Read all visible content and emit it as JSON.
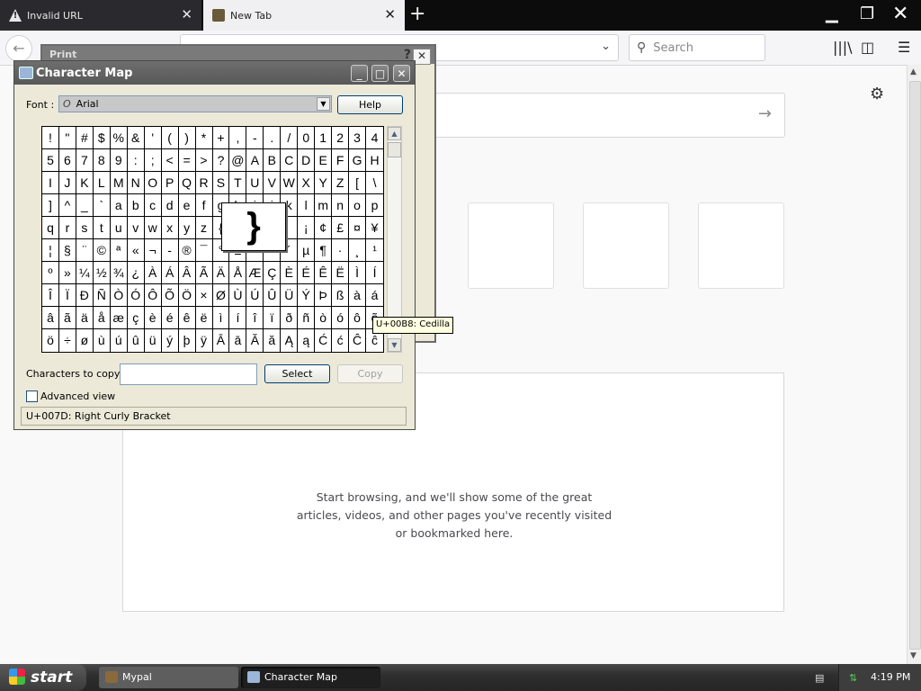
{
  "browser": {
    "tabs": [
      {
        "title": "Invalid URL",
        "icon": "warning-icon"
      },
      {
        "title": "New Tab",
        "icon": "site-icon"
      }
    ],
    "search_placeholder": "Search",
    "empty_message": "Start browsing, and we'll show some of the great articles, videos, and other pages you've recently visited or bookmarked here."
  },
  "print_dialog": {
    "title": "Print",
    "help_glyph": "?"
  },
  "charmap": {
    "title": "Character Map",
    "font_label": "Font :",
    "font_value": "Arial",
    "help_button": "Help",
    "chars_to_copy_label": "Characters to copy :",
    "chars_to_copy_value": "",
    "select_button": "Select",
    "copy_button": "Copy",
    "advanced_view_label": "Advanced view",
    "status": "U+007D: Right Curly Bracket",
    "magnified_char": "}",
    "tooltip": "U+00B8: Cedilla",
    "grid": [
      [
        "!",
        "\"",
        "#",
        "$",
        "%",
        "&",
        "'",
        "(",
        ")",
        "*",
        "+",
        ",",
        "-",
        ".",
        "/",
        "0",
        "1",
        "2",
        "3",
        "4"
      ],
      [
        "5",
        "6",
        "7",
        "8",
        "9",
        ":",
        ";",
        "<",
        "=",
        ">",
        "?",
        "@",
        "A",
        "B",
        "C",
        "D",
        "E",
        "F",
        "G",
        "H"
      ],
      [
        "I",
        "J",
        "K",
        "L",
        "M",
        "N",
        "O",
        "P",
        "Q",
        "R",
        "S",
        "T",
        "U",
        "V",
        "W",
        "X",
        "Y",
        "Z",
        "[",
        "\\"
      ],
      [
        "]",
        "^",
        "_",
        "`",
        "a",
        "b",
        "c",
        "d",
        "e",
        "f",
        "g",
        "h",
        "i",
        "j",
        "k",
        "l",
        "m",
        "n",
        "o",
        "p"
      ],
      [
        "q",
        "r",
        "s",
        "t",
        "u",
        "v",
        "w",
        "x",
        "y",
        "z",
        "{",
        "|",
        "}",
        "~",
        "",
        "¡",
        "¢",
        "£",
        "¤",
        "¥"
      ],
      [
        "¦",
        "§",
        "¨",
        "©",
        "ª",
        "«",
        "¬",
        "-",
        "®",
        "¯",
        "°",
        "±",
        "²",
        "³",
        "´",
        "µ",
        "¶",
        "·",
        "¸",
        "¹"
      ],
      [
        "º",
        "»",
        "¼",
        "½",
        "¾",
        "¿",
        "À",
        "Á",
        "Â",
        "Ã",
        "Ä",
        "Å",
        "Æ",
        "Ç",
        "È",
        "É",
        "Ê",
        "Ë",
        "Ì",
        "Í"
      ],
      [
        "Î",
        "Ï",
        "Ð",
        "Ñ",
        "Ò",
        "Ó",
        "Ô",
        "Õ",
        "Ö",
        "×",
        "Ø",
        "Ù",
        "Ú",
        "Û",
        "Ü",
        "Ý",
        "Þ",
        "ß",
        "à",
        "á"
      ],
      [
        "â",
        "ã",
        "ä",
        "å",
        "æ",
        "ç",
        "è",
        "é",
        "ê",
        "ë",
        "ì",
        "í",
        "î",
        "ï",
        "ð",
        "ñ",
        "ò",
        "ó",
        "ô",
        "õ"
      ],
      [
        "ö",
        "÷",
        "ø",
        "ù",
        "ú",
        "û",
        "ü",
        "ý",
        "þ",
        "ÿ",
        "Ā",
        "ā",
        "Ă",
        "ă",
        "Ą",
        "ą",
        "Ć",
        "ć",
        "Ĉ",
        "ĉ"
      ]
    ]
  },
  "taskbar": {
    "start_label": "start",
    "tasks": [
      {
        "label": "Mypal"
      },
      {
        "label": "Character Map"
      }
    ],
    "clock": "4:19 PM"
  }
}
